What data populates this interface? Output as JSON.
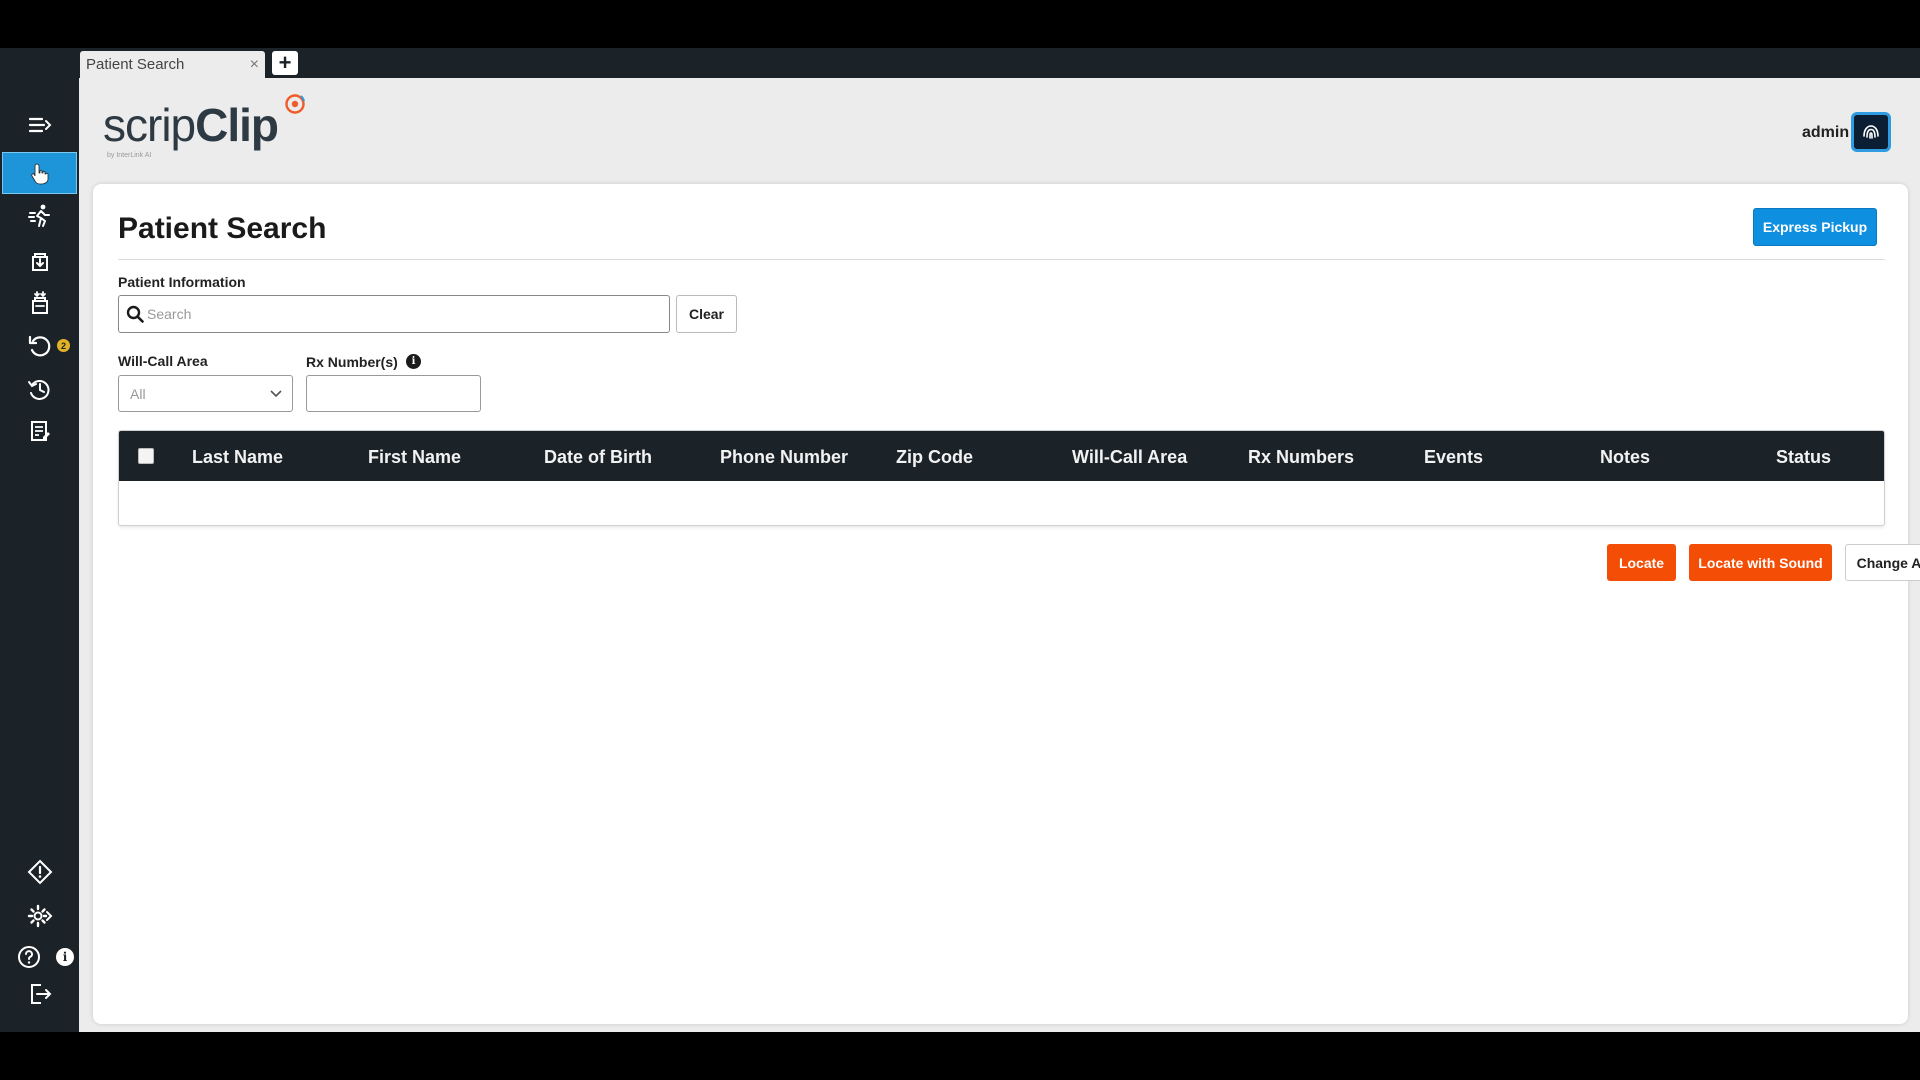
{
  "tab": {
    "label": "Patient Search",
    "close": "×",
    "add": "+"
  },
  "sidebar": {
    "undo_badge": "2",
    "info_badge": "i"
  },
  "logo": {
    "main": "scrip",
    "bold": "Clip",
    "sub": "by InterLink AI"
  },
  "user": {
    "name": "admin"
  },
  "page": {
    "title": "Patient Search",
    "express_pickup": "Express Pickup"
  },
  "form": {
    "patient_info_label": "Patient Information",
    "search_placeholder": "Search",
    "clear": "Clear",
    "will_call_label": "Will-Call Area",
    "will_call_value": "All",
    "rx_label": "Rx Number(s)",
    "rx_info": "i"
  },
  "table": {
    "columns": [
      "Last Name",
      "First Name",
      "Date of Birth",
      "Phone Number",
      "Zip Code",
      "Will-Call Area",
      "Rx Numbers",
      "Events",
      "Notes",
      "Status"
    ]
  },
  "actions": {
    "locate": "Locate",
    "locate_sound": "Locate with Sound",
    "change_area": "Change Area"
  },
  "colors": {
    "sidebar": "#1c2328",
    "accent": "#1e95d8",
    "primary_button": "#0f8fe0",
    "orange_button": "#f44d06",
    "badge": "#e3b326"
  }
}
